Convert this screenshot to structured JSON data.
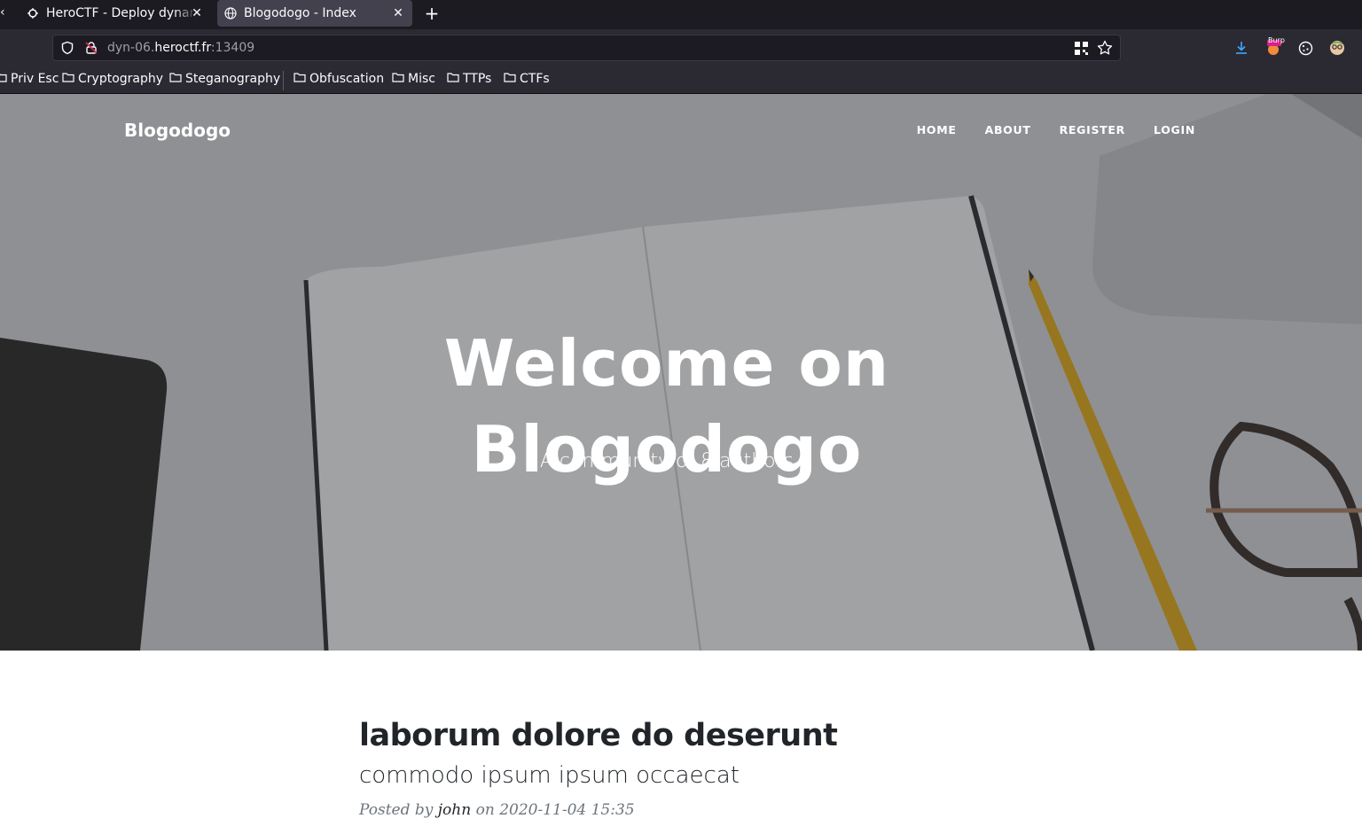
{
  "browser": {
    "tabs": [
      {
        "title": "HeroCTF - Deploy dynamic",
        "active": false
      },
      {
        "title": "Blogodogo - Index",
        "active": true
      }
    ],
    "url": {
      "prefix": "dyn-06.",
      "host": "heroctf.fr",
      "suffix": ":13409"
    },
    "bookmarks": [
      "Priv Esc",
      "Cryptography",
      "Steganography",
      "Obfuscation",
      "Misc",
      "TTPs",
      "CTFs"
    ],
    "extension_badge": "Burp"
  },
  "site": {
    "brand": "Blogodogo",
    "nav": [
      "HOME",
      "ABOUT",
      "REGISTER",
      "LOGIN"
    ],
    "hero": {
      "title_line1": "Welcome on",
      "title_line2": "Blogodogo",
      "subtitle": "A community of 8 authors"
    },
    "post": {
      "title": "laborum dolore do deserunt",
      "subtitle": "commodo ipsum ipsum occaecat",
      "posted_by_label": "Posted by",
      "author": "john",
      "on_label": "on",
      "date": "2020-11-04 15:35"
    }
  },
  "colors": {
    "tabbar": "#1c1b22",
    "toolbar": "#2b2a33",
    "accent_download": "#0df"
  }
}
